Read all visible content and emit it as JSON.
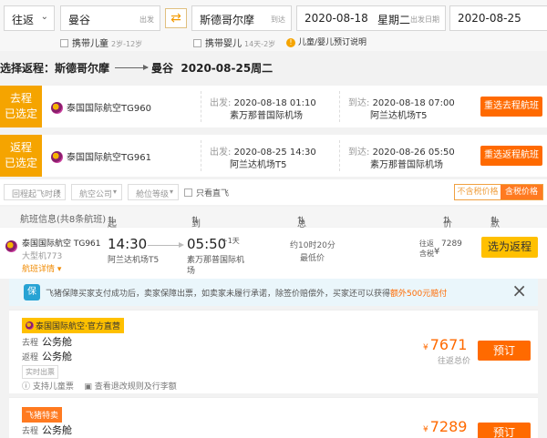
{
  "search": {
    "trip_type": "往返",
    "from_city": "曼谷",
    "from_hint": "出发",
    "to_city": "斯德哥尔摩",
    "to_hint": "到达",
    "depart_date": "2020-08-18",
    "depart_weekday": "星期二",
    "depart_hint": "出发日期",
    "return_date": "2020-08-25",
    "child_label": "携带儿童",
    "child_age": "2岁-12岁",
    "infant_label": "携带婴儿",
    "infant_age": "14天-2岁",
    "booking_note": "儿童/婴儿预订说明"
  },
  "route_title": {
    "prefix": "选择返程：",
    "from": "斯德哥尔摩",
    "to": "曼谷",
    "date": "2020-08-25周二"
  },
  "outbound": {
    "tag_line1": "去程",
    "tag_line2": "已选定",
    "airline": "泰国国际航空TG960",
    "dep_label": "出发:",
    "dep_time": "2020-08-18 01:10",
    "dep_airport": "素万那普国际机场",
    "arr_label": "到达:",
    "arr_time": "2020-08-18 07:00",
    "arr_airport": "阿兰达机场T5",
    "reselect": "重选去程航班"
  },
  "return_leg": {
    "tag_line1": "返程",
    "tag_line2": "已选定",
    "airline": "泰国国际航空TG961",
    "dep_label": "出发:",
    "dep_time": "2020-08-25 14:30",
    "dep_airport": "阿兰达机场T5",
    "arr_label": "到达:",
    "arr_time": "2020-08-26 05:50",
    "arr_airport": "素万那普国际机场",
    "reselect": "重选返程航班"
  },
  "filters": {
    "time": "回程起飞时段",
    "airline": "航空公司",
    "cabin": "舱位等级",
    "direct_only": "只看直飞",
    "price_excl_tax": "不含税价格",
    "price_incl_tax": "含税价格"
  },
  "table_header": {
    "flight_info": "航班信息(共8条航班)",
    "dep_time": "起飞时间",
    "arr_time": "到达时间",
    "duration": "总耗时",
    "price": "价格",
    "sort": "默认排序"
  },
  "flight": {
    "airline": "泰国国际航空 TG961",
    "aircraft": "大型机773",
    "details": "航班详情",
    "dep_time": "14:30",
    "dep_airport": "阿兰达机场T5",
    "arr_time": "05:50",
    "arr_plus": "+1天",
    "arr_airport_l1": "素万那普国际机",
    "arr_airport_l2": "场",
    "duration": "约10时20分",
    "duration_note": "最低价",
    "price_label_1": "往返",
    "price_label_2": "含税",
    "currency": "¥",
    "price": "7289",
    "select_button": "选为返程"
  },
  "guarantee": {
    "text_before": "飞猪保障买家支付成功后，卖家保障出票，如卖家未履行承诺，除签价赔偿外，买家还可以获得",
    "text_highlight": "额外500元赔付"
  },
  "fares": [
    {
      "badge": "泰国国际航空·官方直营",
      "out_label": "去程",
      "out_cabin": "公务舱",
      "ret_label": "返程",
      "ret_cabin": "公务舱",
      "tag": "实时出票",
      "link1": "支持儿童票",
      "link2": "查看退改规则及行李额",
      "currency": "¥",
      "price": "7671",
      "price_note": "往返总价",
      "book": "预订"
    },
    {
      "badge": "飞猪特卖",
      "out_label": "去程",
      "out_cabin": "公务舱",
      "currency": "¥",
      "price": "7289",
      "book": "预订"
    }
  ],
  "colors": {
    "accent_orange": "#ff6a00",
    "tag_yellow": "#f5a400",
    "button_yellow": "#ffc000"
  }
}
